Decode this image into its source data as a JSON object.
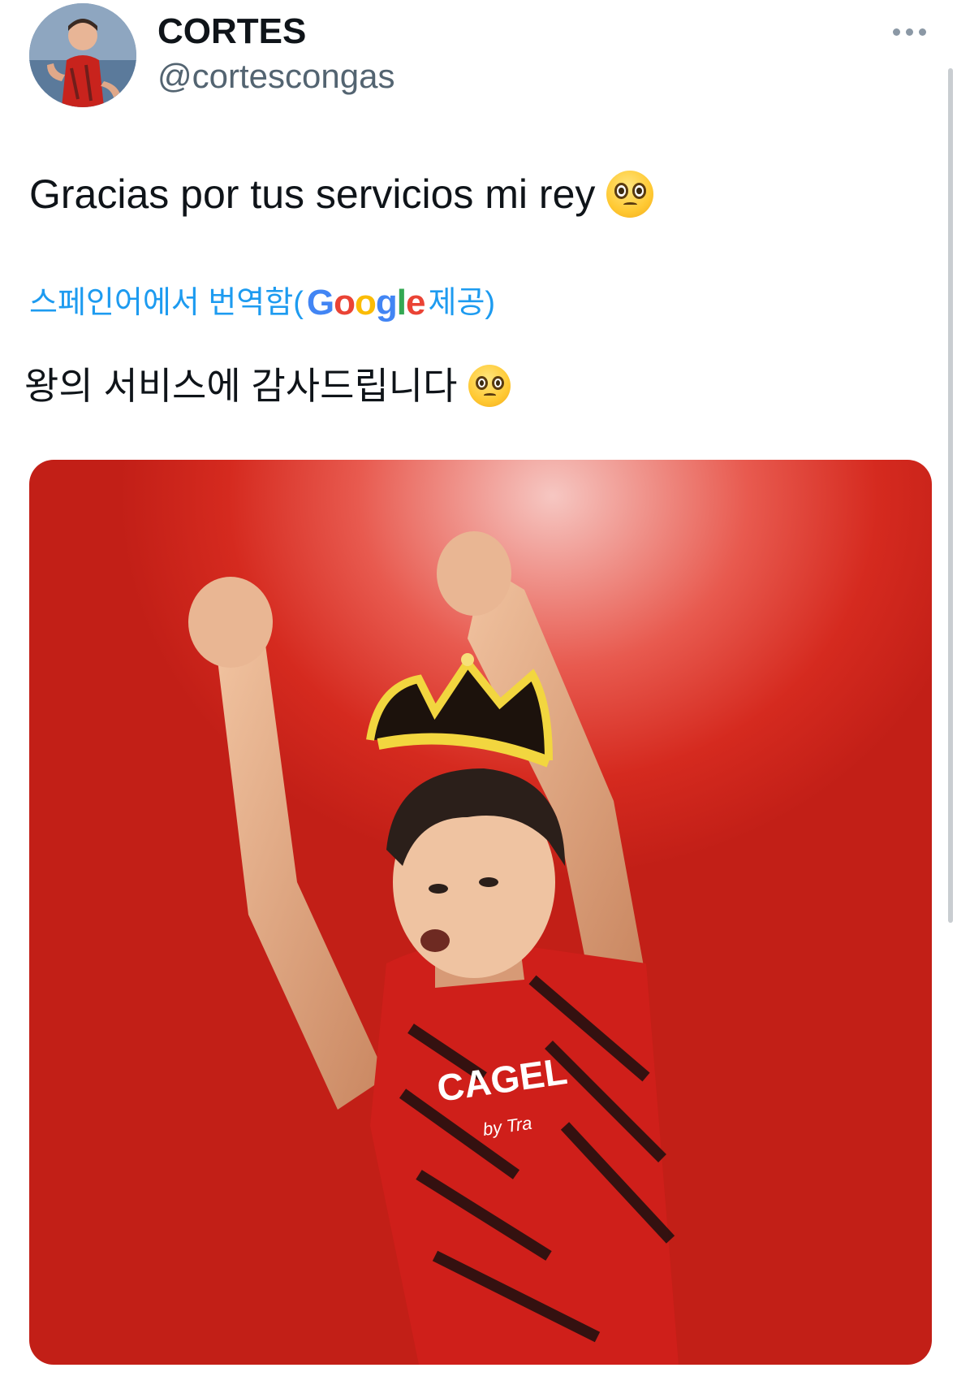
{
  "tweet": {
    "author": {
      "display_name": "CORTES",
      "handle": "@cortescongas"
    },
    "text": "Gracias por tus servicios mi rey",
    "text_emoji": "pleading-face",
    "translation": {
      "prefix": "스페인어에서 번역함(",
      "provider_g1": "G",
      "provider_o1": "o",
      "provider_o2": "o",
      "provider_g2": "g",
      "provider_l": "l",
      "provider_e": "e",
      "suffix": " 제공)",
      "text": "왕의 서비스에 감사드립니다",
      "text_emoji": "pleading-face"
    },
    "media": {
      "jersey_sponsor": "CAGEL",
      "jersey_sponsor_sub": "by Tra"
    }
  },
  "colors": {
    "link": "#1d9bf0",
    "secondary_text": "#536471",
    "media_red": "#d52a1f",
    "google_blue": "#4285f4",
    "google_red": "#ea4335",
    "google_yellow": "#fbbc05",
    "google_green": "#34a853"
  },
  "icons": {
    "more": "more-horizontal-icon",
    "emoji": "pleading-face-emoji"
  }
}
